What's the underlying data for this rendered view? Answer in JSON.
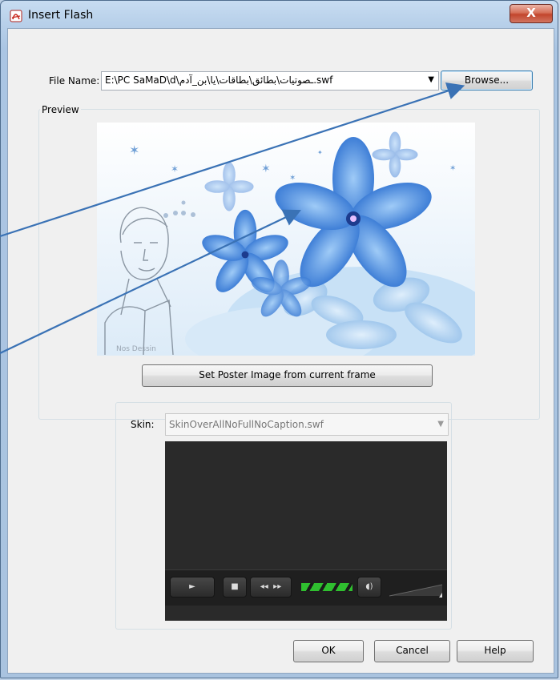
{
  "window": {
    "title": "Insert Flash",
    "close_label": "X",
    "icon": "pdf-icon"
  },
  "file": {
    "label": "File Name:",
    "value": "E:\\PC SaMaD\\d\\صوتيات\\بطائق\\بطاقات\\يا ابن آدم.swf",
    "display": "E:\\PC SaMaD\\d\\ـصوتيات\\بطائق\\بطاقات\\يا\\بن_آدم.swf",
    "browse_label": "Browse..."
  },
  "preview": {
    "group_label": "Preview",
    "poster_button_label": "Set Poster Image from current frame",
    "image_caption": "Nos Dessin"
  },
  "skin": {
    "label": "Skin:",
    "value": "SkinOverAllNoFullNoCaption.swf"
  },
  "player": {
    "play_icon": "play-icon",
    "stop_icon": "stop-icon",
    "rewind_icon": "rewind-icon",
    "forward_icon": "fast-forward-icon",
    "volume_icon": "volume-icon"
  },
  "footer": {
    "ok_label": "OK",
    "cancel_label": "Cancel",
    "help_label": "Help"
  },
  "colors": {
    "accent": "#3c7fb1",
    "arrow": "#3a72b5",
    "close": "#c2452c"
  }
}
